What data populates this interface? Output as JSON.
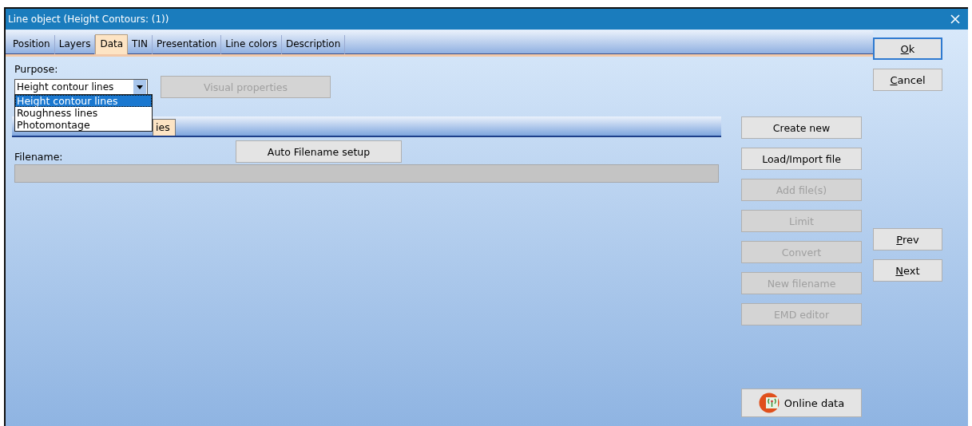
{
  "window": {
    "title": "Line object  (Height Contours: (1))"
  },
  "tabs": [
    {
      "label": "Position",
      "selected": false
    },
    {
      "label": "Layers",
      "selected": false
    },
    {
      "label": "Data",
      "selected": true
    },
    {
      "label": "TIN",
      "selected": false
    },
    {
      "label": "Presentation",
      "selected": false
    },
    {
      "label": "Line colors",
      "selected": false
    },
    {
      "label": "Description",
      "selected": false
    }
  ],
  "purpose": {
    "label": "Purpose:",
    "value": "Height contour lines",
    "options": [
      {
        "label": "Height contour lines",
        "selected": true
      },
      {
        "label": "Roughness lines",
        "selected": false
      },
      {
        "label": "Photomontage",
        "selected": false
      }
    ]
  },
  "visual_properties_button": {
    "label": "Visual properties",
    "disabled": true
  },
  "inner_tab": {
    "label": "ies"
  },
  "auto_filename_button": {
    "label": "Auto Filename setup"
  },
  "filename": {
    "label": "Filename:"
  },
  "action_buttons": [
    {
      "label": "Create new",
      "disabled": false
    },
    {
      "label": "Load/Import file",
      "disabled": false
    },
    {
      "label": "Add file(s)",
      "disabled": true
    },
    {
      "label": "Limit",
      "disabled": true
    },
    {
      "label": "Convert",
      "disabled": true
    },
    {
      "label": "New filename",
      "disabled": true
    },
    {
      "label": "EMD editor",
      "disabled": true
    }
  ],
  "online_data_button": {
    "label": "Online data"
  },
  "dialog_buttons": [
    {
      "label": "Ok"
    },
    {
      "label": "Cancel"
    }
  ],
  "nav_buttons": [
    {
      "label": "Prev"
    },
    {
      "label": "Next"
    }
  ]
}
